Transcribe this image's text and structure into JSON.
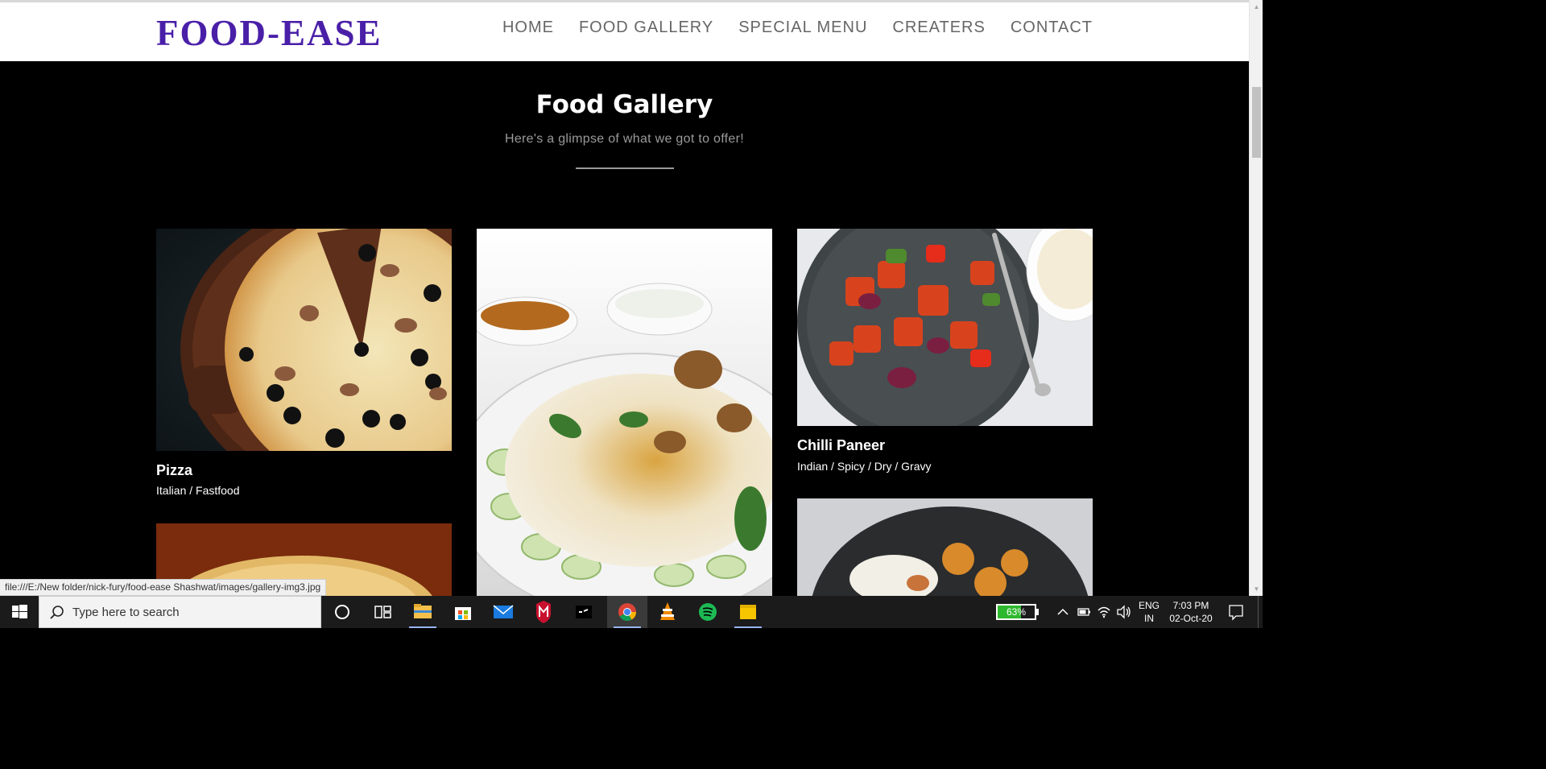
{
  "header": {
    "logo": "FOOD-EASE",
    "nav": [
      "HOME",
      "FOOD GALLERY",
      "SPECIAL MENU",
      "CREATERS",
      "CONTACT"
    ]
  },
  "gallery": {
    "title": "Food Gallery",
    "subtitle": "Here's a glimpse of what we got to offer!",
    "items": [
      {
        "title": "Pizza",
        "tags": "Italian / Fastfood"
      },
      {
        "title": "Chilli Paneer",
        "tags": "Indian / Spicy / Dry / Gravy"
      }
    ]
  },
  "status_url": "file:///E:/New folder/nick-fury/food-ease Shashwat/images/gallery-img3.jpg",
  "taskbar": {
    "search_placeholder": "Type here to search",
    "battery": "63%",
    "lang_top": "ENG",
    "lang_bottom": "IN",
    "time": "7:03 PM",
    "date": "02-Oct-20"
  },
  "colors": {
    "brand": "#4a1fa8",
    "nav_text": "#666666",
    "page_bg": "#000000"
  }
}
